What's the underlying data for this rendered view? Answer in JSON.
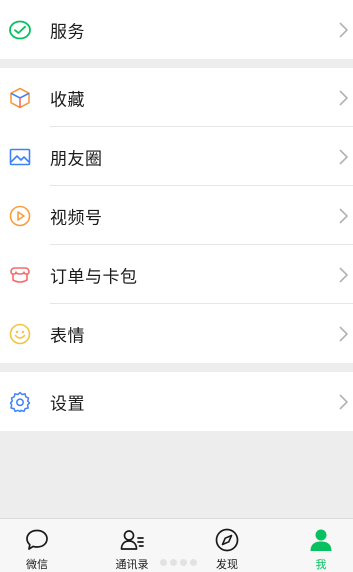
{
  "menu": {
    "services": {
      "label": "服务"
    },
    "favorites": {
      "label": "收藏"
    },
    "moments": {
      "label": "朋友圈"
    },
    "channels": {
      "label": "视频号"
    },
    "cards": {
      "label": "订单与卡包"
    },
    "stickers": {
      "label": "表情"
    },
    "settings": {
      "label": "设置"
    }
  },
  "tabbar": {
    "tabs": [
      {
        "label": "微信",
        "icon": "chat-bubble-icon"
      },
      {
        "label": "通讯录",
        "icon": "contacts-icon"
      },
      {
        "label": "发现",
        "icon": "compass-icon"
      },
      {
        "label": "我",
        "icon": "person-icon",
        "active": true
      }
    ]
  },
  "colors": {
    "accent": "#07c160",
    "background": "#ededed",
    "chevron": "#b2b2b2",
    "favorites_orange": "#f79a3e",
    "moments_blue": "#3e82f7",
    "channels_orange": "#fa9d3b",
    "cards_red": "#f56c6c",
    "stickers_yellow": "#f5c342",
    "settings_blue": "#3e82f7"
  }
}
